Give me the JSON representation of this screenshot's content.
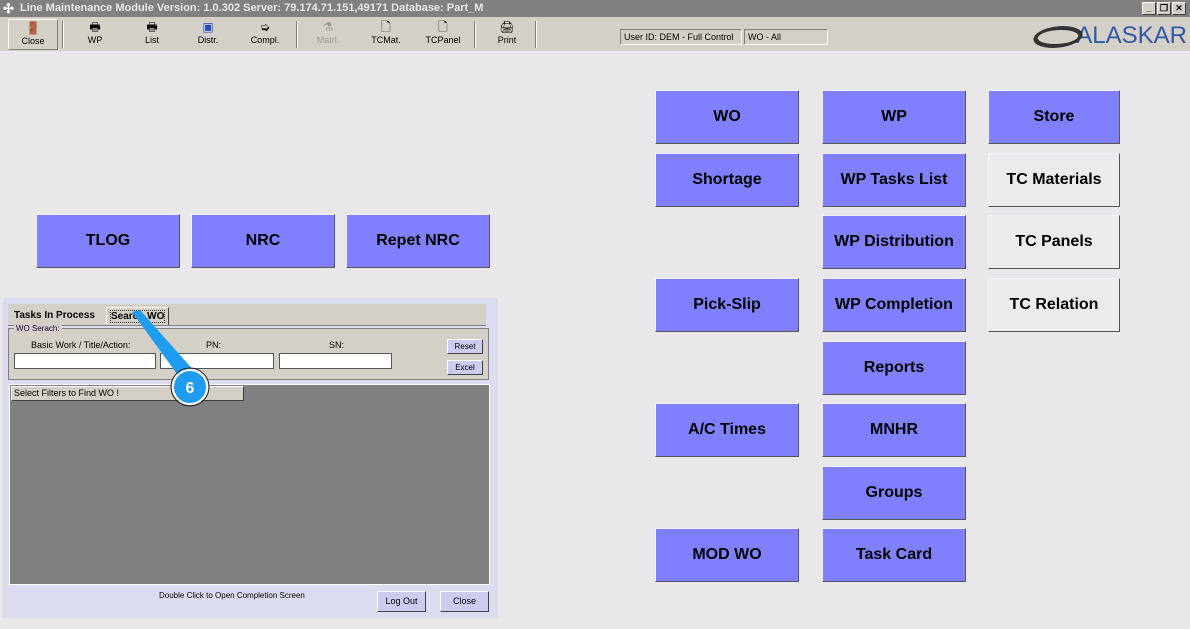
{
  "window": {
    "title": "Line Maintenance Module  Version: 1.0.302 Server: 79.174.71.151,49171 Database: Part_M",
    "min": "_",
    "max": "❐",
    "close": "✕"
  },
  "toolbar": [
    {
      "label": "Close",
      "icon": "exit-door-icon",
      "glyph": "🚪"
    },
    {
      "label": "WP",
      "icon": "printer-doc-icon",
      "glyph": "🖶"
    },
    {
      "label": "List",
      "icon": "printer-doc-icon",
      "glyph": "🖶"
    },
    {
      "label": "Distr.",
      "icon": "distribute-icon",
      "glyph": "▣"
    },
    {
      "label": "Compl.",
      "icon": "compl-icon",
      "glyph": "➭"
    },
    {
      "label": "Matrl.",
      "icon": "material-icon",
      "glyph": "⚗"
    },
    {
      "label": "TCMat.",
      "icon": "document-icon",
      "glyph": "🗋"
    },
    {
      "label": "TCPanel",
      "icon": "document-icon",
      "glyph": "🗋"
    },
    {
      "label": "Print",
      "icon": "printer-icon",
      "glyph": "🖨"
    }
  ],
  "status": {
    "user": "User ID: DEM - Full Control",
    "wo": "WO - All"
  },
  "logo": "ALASKAR",
  "menu": {
    "wo": "WO",
    "wp": "WP",
    "store": "Store",
    "shortage": "Shortage",
    "wp_tasks": "WP Tasks List",
    "tc_materials": "TC Materials",
    "tlog": "TLOG",
    "nrc": "NRC",
    "repet_nrc": "Repet NRC",
    "wp_distribution": "WP Distribution",
    "tc_panels": "TC Panels",
    "pick_slip": "Pick-Slip",
    "wp_completion": "WP Completion",
    "tc_relation": "TC Relation",
    "reports": "Reports",
    "ac_times": "A/C Times",
    "mnhr": "MNHR",
    "groups": "Groups",
    "mod_wo": "MOD WO",
    "task_card": "Task Card"
  },
  "panel": {
    "tabs": [
      "Tasks In Process",
      "Search WO"
    ],
    "group": "WO Serach:",
    "basic_label": "Basic Work / Title/Action:",
    "pn_label": "PN:",
    "sn_label": "SN:",
    "basic_value": "",
    "pn_value": "",
    "sn_value": "",
    "reset": "Reset",
    "excel": "Excel",
    "grid_header": "Select Filters to Find WO !",
    "hint": "Double Click to Open Completion Screen",
    "logout": "Log Out",
    "close": "Close"
  },
  "callout": {
    "number": "6"
  }
}
